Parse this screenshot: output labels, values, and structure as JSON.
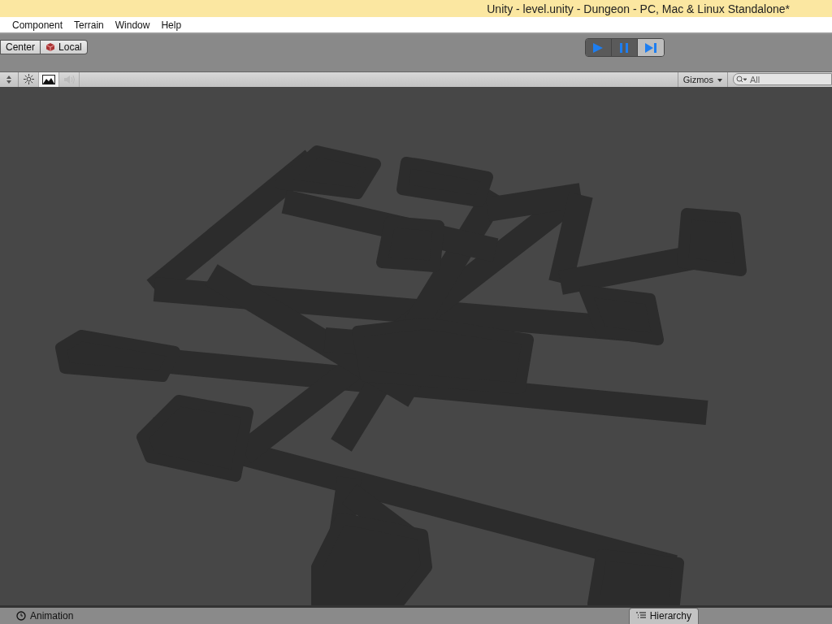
{
  "window": {
    "title": "Unity - level.unity - Dungeon - PC, Mac & Linux Standalone*"
  },
  "menu": [
    "Component",
    "Terrain",
    "Window",
    "Help"
  ],
  "toolbar": {
    "pivot_buttons": [
      {
        "label": "Center",
        "kind": "text"
      },
      {
        "label": "Local",
        "kind": "local"
      }
    ],
    "playback": [
      {
        "kind": "play",
        "on": true
      },
      {
        "kind": "pause",
        "on": true
      },
      {
        "kind": "step",
        "on": false
      }
    ]
  },
  "scene_toolbar": {
    "toggles": [
      {
        "kind": "lighting",
        "on": false
      },
      {
        "kind": "effects",
        "on": true
      },
      {
        "kind": "audio",
        "on": false
      }
    ],
    "gizmos": "Gizmos",
    "search": {
      "placeholder": "All"
    }
  },
  "bottom_tabs": [
    {
      "label": "Animation",
      "kind": "animation",
      "selected": false
    },
    {
      "label": "Hierarchy",
      "kind": "hierarchy",
      "selected": true
    }
  ]
}
